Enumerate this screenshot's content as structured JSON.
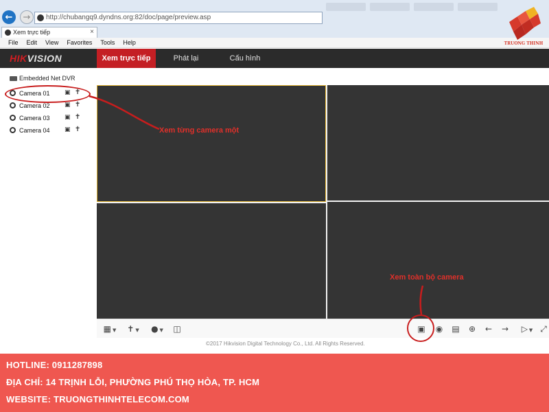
{
  "browser": {
    "url": "http://chubangq9.dyndns.org:82/doc/page/preview.asp",
    "tab_title": "Xem trực tiếp",
    "tab_close": "×",
    "menu": [
      "File",
      "Edit",
      "View",
      "Favorites",
      "Tools",
      "Help"
    ]
  },
  "logo": {
    "text": "TRUONG THINH",
    "colors": [
      "#d63a2c",
      "#f0b323"
    ]
  },
  "app": {
    "brand_red": "HIK",
    "brand_rest": "VISION",
    "tabs": [
      "Xem trực tiếp",
      "Phát lại",
      "Cấu hình"
    ],
    "active_tab": 0,
    "accent": "#c41f24"
  },
  "sidebar": {
    "device": "Embedded Net DVR",
    "cameras": [
      "Camera 01",
      "Camera 02",
      "Camera 03",
      "Camera 04"
    ]
  },
  "annotations": {
    "single": "Xem từng camera một",
    "all": "Xem toàn bộ camera"
  },
  "toolbar": {
    "icons": [
      "layout-icon",
      "ptz-icon",
      "microphone-icon",
      "stream-icon",
      "all-cameras-icon",
      "capture-icon",
      "record-icon",
      "zoom-icon",
      "prev-icon",
      "next-icon",
      "volume-icon",
      "fullscreen-icon"
    ]
  },
  "copyright": "©2017 Hikvision Digital Technology Co., Ltd. All Rights Reserved.",
  "banner": {
    "hotline": "HOTLINE: 0911287898",
    "address": "ĐỊA CHỈ: 14 TRỊNH LỖI, PHƯỜNG PHÚ THỌ HÒA, TP. HCM",
    "website": "WEBSITE: TRUONGTHINHTELECOM.COM",
    "color": "#ef5750"
  }
}
